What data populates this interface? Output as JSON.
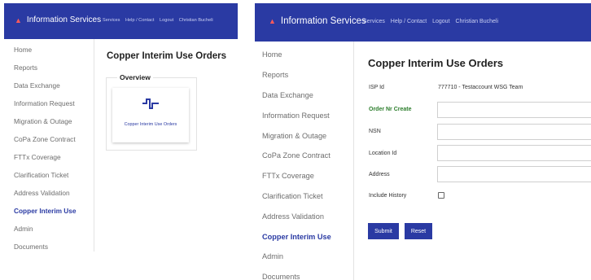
{
  "header": {
    "brand": "Information Services",
    "links": [
      "Services",
      "Help / Contact",
      "Logout",
      "Christian Bucheli"
    ]
  },
  "sidebar": {
    "items": [
      {
        "label": "Home"
      },
      {
        "label": "Reports"
      },
      {
        "label": "Data Exchange"
      },
      {
        "label": "Information Request"
      },
      {
        "label": "Migration & Outage"
      },
      {
        "label": "CoPa Zone Contract"
      },
      {
        "label": "FTTx Coverage"
      },
      {
        "label": "Clarification Ticket"
      },
      {
        "label": "Address Validation"
      },
      {
        "label": "Copper Interim Use",
        "active": true
      },
      {
        "label": "Admin"
      },
      {
        "label": "Documents"
      }
    ]
  },
  "overview_page": {
    "title": "Copper Interim Use Orders",
    "section": "Overview",
    "card": {
      "icon": "signal-pulse-icon",
      "label": "Copper Interim Use Orders"
    }
  },
  "orders_page": {
    "title": "Copper Interim Use Orders",
    "fields": [
      {
        "label": "ISP Id",
        "value": "777710 - Testaccount WSG Team"
      },
      {
        "label": "Order Nr Create",
        "value": ""
      },
      {
        "label": "NSN",
        "value": ""
      },
      {
        "label": "Location Id",
        "value": ""
      },
      {
        "label": "Address",
        "value": ""
      },
      {
        "label": "Include History",
        "checked": false
      }
    ],
    "buttons": {
      "submit": "Submit",
      "reset": "Reset"
    }
  },
  "colors": {
    "brand": "#2a3aa3",
    "logo": "#ff5a5a",
    "required_label": "#2b7d2b"
  }
}
